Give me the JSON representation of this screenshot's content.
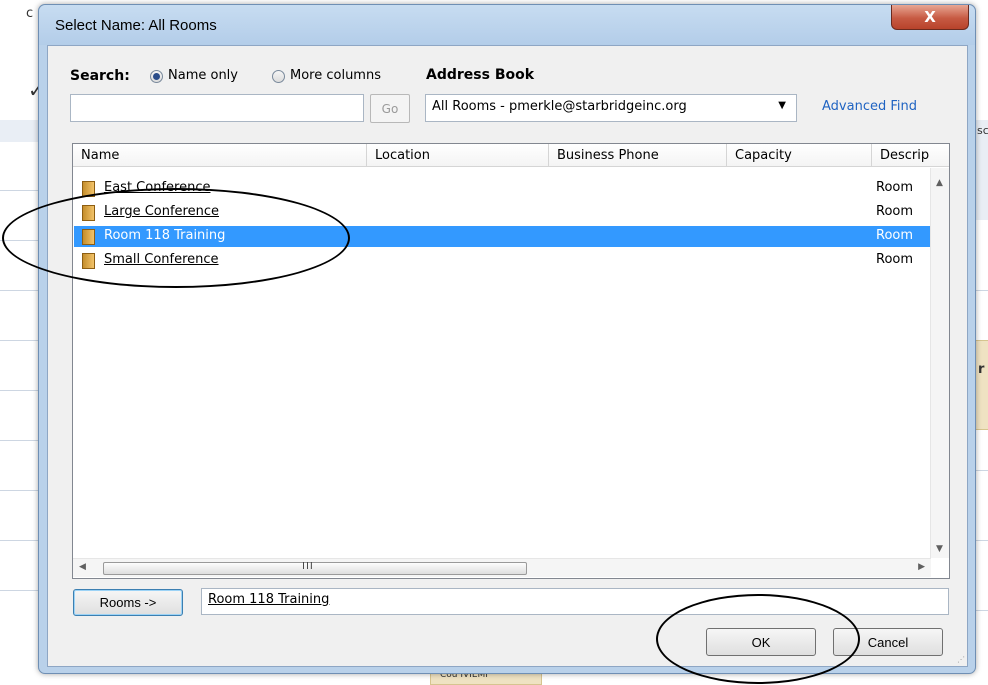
{
  "window": {
    "title": "Select Name: All Rooms",
    "close_glyph": "X"
  },
  "search": {
    "label": "Search:",
    "option_name_only": "Name only",
    "option_more_columns": "More columns",
    "selected_option": "Name only",
    "query_value": "",
    "go_label": "Go"
  },
  "address_book": {
    "label": "Address Book",
    "selected_value": "All Rooms - pmerkle@starbridgeinc.org",
    "advanced_find_label": "Advanced Find"
  },
  "list": {
    "columns": [
      "Name",
      "Location",
      "Business Phone",
      "Capacity",
      "Descrip"
    ],
    "rows": [
      {
        "name": "East Conference",
        "description": "Room"
      },
      {
        "name": "Large Conference",
        "description": "Room"
      },
      {
        "name": "Room 118 Training",
        "description": "Room"
      },
      {
        "name": "Small Conference",
        "description": "Room"
      }
    ],
    "selected_row": "Room 118 Training",
    "hscroll_grip": "III"
  },
  "bottom": {
    "rooms_button_label": "Rooms ->",
    "rooms_value": "Room 118 Training",
    "ok_label": "OK",
    "cancel_label": "Cancel"
  },
  "background": {
    "partial_text_left": "c",
    "partial_text_right_1": "sc",
    "partial_text_right_2": "r",
    "partial_text_bottom": "Cou IVIEMI"
  }
}
